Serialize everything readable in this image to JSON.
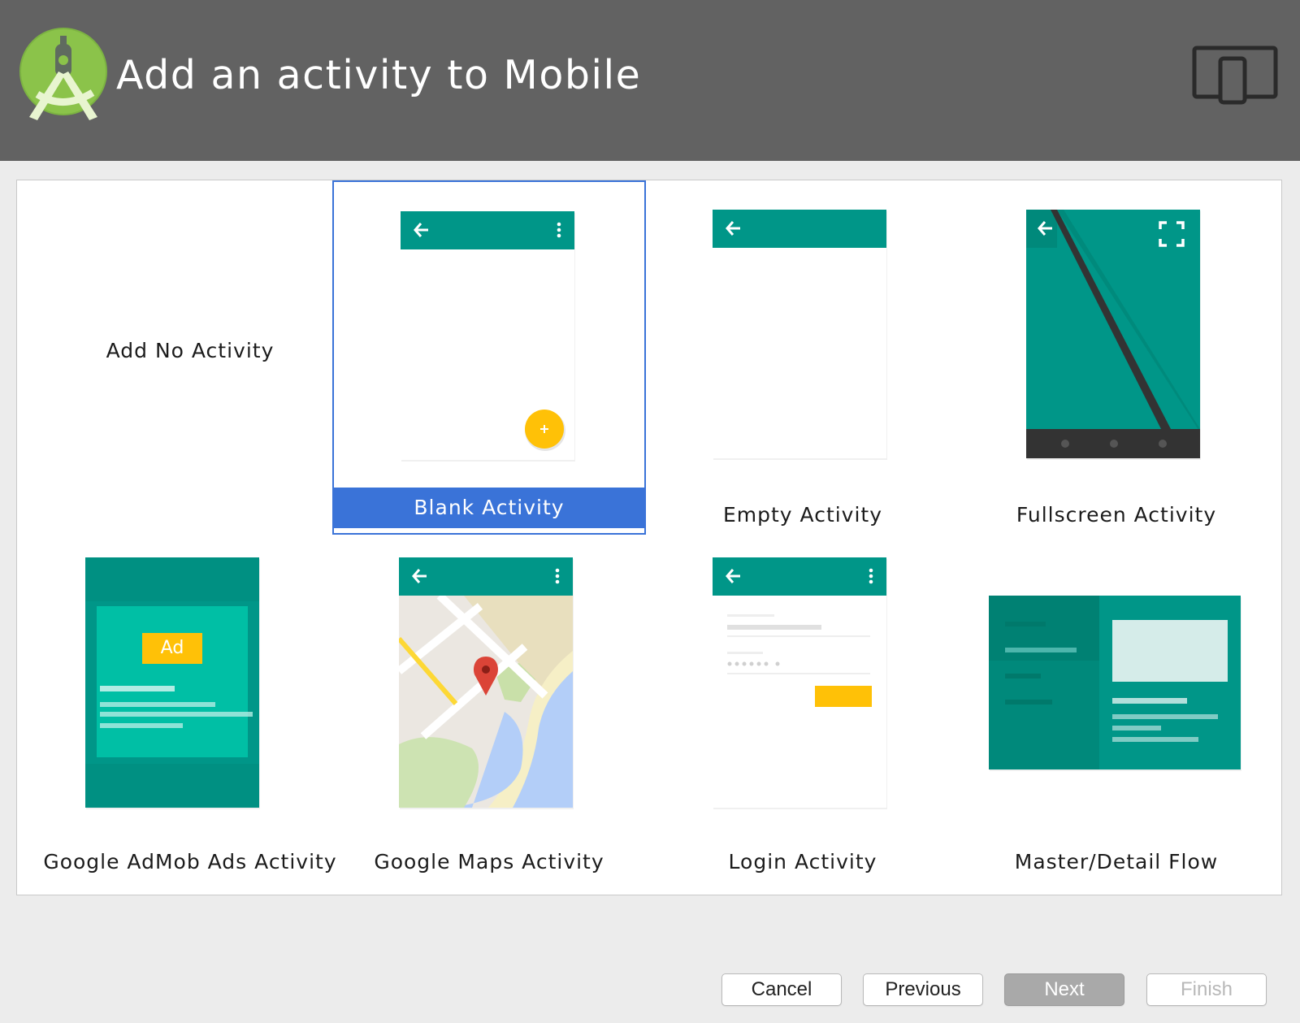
{
  "header": {
    "title": "Add an activity to Mobile",
    "logo_icon": "android-studio-logo-icon",
    "device_icon": "phone-tablet-icon"
  },
  "colors": {
    "header_bg": "#626262",
    "teal": "#009688",
    "teal_dark": "#00796b",
    "selection": "#3a73d8",
    "accent_yellow": "#ffc107"
  },
  "activities": [
    {
      "label": "Add No Activity",
      "selected": false
    },
    {
      "label": "Blank Activity",
      "selected": true
    },
    {
      "label": "Empty Activity",
      "selected": false
    },
    {
      "label": "Fullscreen Activity",
      "selected": false
    },
    {
      "label": "Google AdMob Ads Activity",
      "selected": false
    },
    {
      "label": "Google Maps Activity",
      "selected": false
    },
    {
      "label": "Login Activity",
      "selected": false
    },
    {
      "label": "Master/Detail Flow",
      "selected": false
    }
  ],
  "admob": {
    "ad_label": "Ad"
  },
  "footer": {
    "cancel": "Cancel",
    "previous": "Previous",
    "next": "Next",
    "finish": "Finish"
  }
}
